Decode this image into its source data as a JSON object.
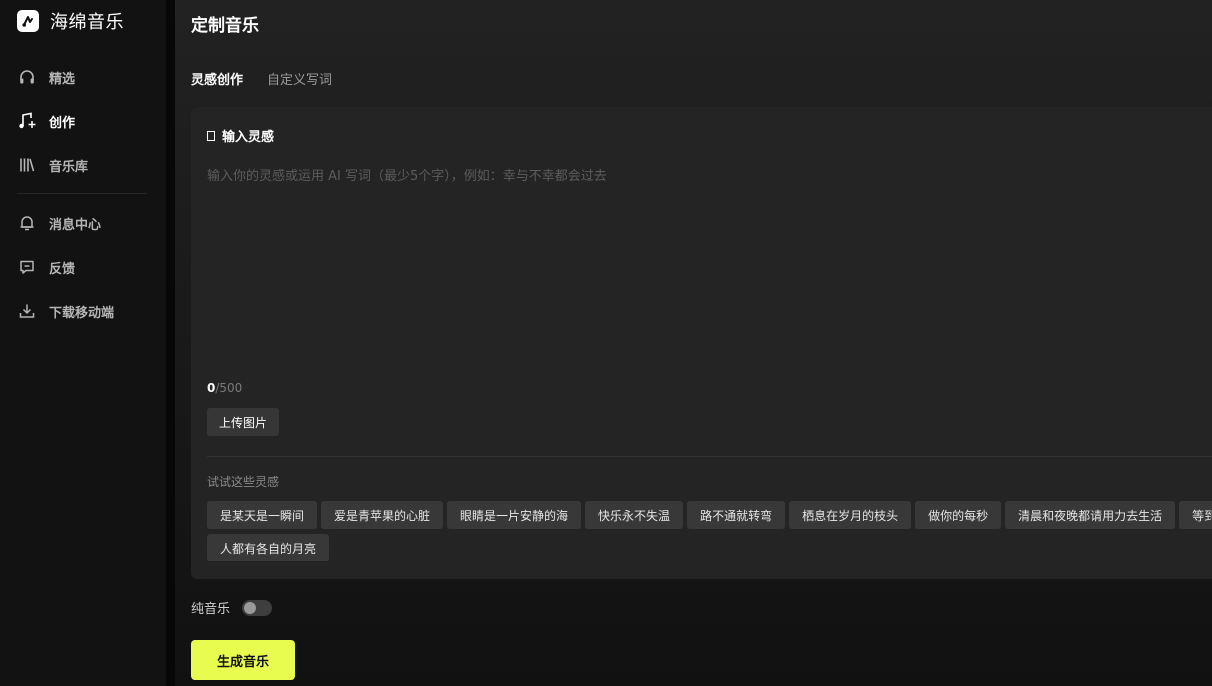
{
  "app": {
    "name": "海绵音乐"
  },
  "sidebar": {
    "items": [
      {
        "label": "精选",
        "icon": "headphones-icon"
      },
      {
        "label": "创作",
        "icon": "music-note-sparkle-icon",
        "active": true
      },
      {
        "label": "音乐库",
        "icon": "library-icon"
      },
      {
        "label": "消息中心",
        "icon": "bell-icon"
      },
      {
        "label": "反馈",
        "icon": "feedback-message-icon"
      },
      {
        "label": "下载移动端",
        "icon": "download-icon"
      }
    ]
  },
  "main": {
    "title": "定制音乐",
    "tabs": [
      {
        "label": "灵感创作",
        "active": true
      },
      {
        "label": "自定义写词"
      }
    ],
    "inspiration": {
      "label": "输入灵感",
      "placeholder": "输入你的灵感或运用 AI 写词（最少5个字），例如：幸与不幸都会过去",
      "value": "",
      "count": "0",
      "max": "/500",
      "upload_label": "上传图片",
      "suggest_title": "试试这些灵感",
      "suggestions_row1": [
        "是某天是一瞬间",
        "爱是青苹果的心脏",
        "眼睛是一片安静的海",
        "快乐永不失温",
        "路不通就转弯",
        "栖息在岁月的枝头",
        "做你的每秒",
        "清晨和夜晚都请用力去生活",
        "等到"
      ],
      "suggestions_row2": [
        "人都有各自的月亮"
      ]
    },
    "pure_music_label": "纯音乐",
    "pure_music_on": false,
    "generate_label": "生成音乐"
  },
  "colors": {
    "accent": "#e8fc4f",
    "background": "#0d0d0d",
    "sidebar": "#121212",
    "card": "#242424"
  }
}
